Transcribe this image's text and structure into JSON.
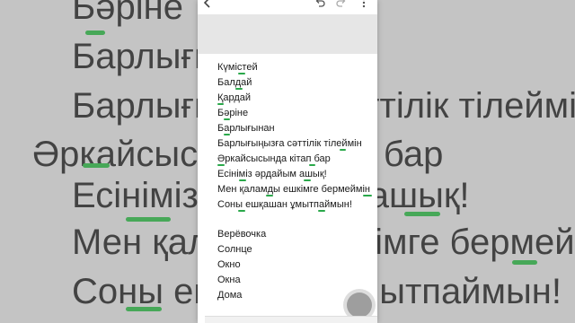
{
  "background_lines": [
    "Бәріне",
    "Барлығына",
    "Барлығыңызға сәттілік тілеймін",
    "Әркайсысында кітап бар",
    "Есініміз әрдайым ашық!",
    "Мен қаламды ешкімге бермеймін",
    "Соны ешқашан ұмытпаймын!"
  ],
  "toolbar": {
    "back_icon": "back-arrow-icon",
    "undo_icon": "undo-icon",
    "redo_icon": "redo-icon",
    "menu_icon": "more-vert-icon"
  },
  "document": {
    "kazakh_lines": [
      "Күмістей",
      "Балдай",
      "Қардай",
      "Бәріне",
      "Барлығынан",
      "Барлығыңызға сәттілік тілеймін",
      "Әркайсысында кітап бар",
      "Есініміз әрдайым ашық!",
      "Мен қаламды ешкімге бермеймін",
      "Соны ешқашан ұмытпаймын!"
    ],
    "russian_lines": [
      "Верёвочка",
      "Солнце",
      "Окно",
      "Окна",
      "Дома"
    ]
  },
  "colors": {
    "spellcheck": "#2aa84a",
    "fab": "#9e9e9e"
  }
}
